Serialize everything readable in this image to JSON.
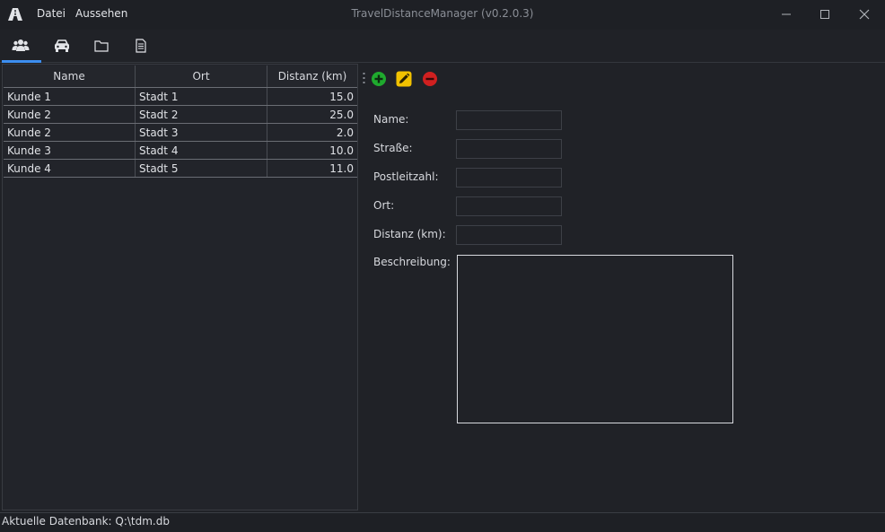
{
  "window": {
    "title": "TravelDistanceManager (v0.2.0.3)",
    "menu": [
      "Datei",
      "Aussehen"
    ]
  },
  "tabs": [
    {
      "icon": "users-icon",
      "active": true
    },
    {
      "icon": "car-icon",
      "active": false
    },
    {
      "icon": "folder-icon",
      "active": false
    },
    {
      "icon": "document-icon",
      "active": false
    }
  ],
  "table": {
    "columns": [
      "Name",
      "Ort",
      "Distanz (km)"
    ],
    "rows": [
      [
        "Kunde 1",
        "Stadt 1",
        "15.0"
      ],
      [
        "Kunde 2",
        "Stadt 2",
        "25.0"
      ],
      [
        "Kunde 2",
        "Stadt 3",
        "2.0"
      ],
      [
        "Kunde 3",
        "Stadt 4",
        "10.0"
      ],
      [
        "Kunde 4",
        "Stadt 5",
        "11.0"
      ]
    ]
  },
  "toolbar": {
    "add_icon": "plus-circle-icon",
    "edit_icon": "pencil-icon",
    "delete_icon": "minus-circle-icon",
    "colors": {
      "add": "#1faa2e",
      "edit": "#f2c200",
      "delete": "#d02020"
    }
  },
  "form": {
    "labels": {
      "name": "Name:",
      "street": "Straße:",
      "postcode": "Postleitzahl:",
      "city": "Ort:",
      "distance": "Distanz (km):",
      "description": "Beschreibung:"
    },
    "values": {
      "name": "",
      "street": "",
      "postcode": "",
      "city": "",
      "distance": "",
      "description": ""
    }
  },
  "status": {
    "text": "Aktuelle Datenbank: Q:\\tdm.db"
  },
  "colors": {
    "accent": "#3c8ef0",
    "background": "#202227"
  }
}
